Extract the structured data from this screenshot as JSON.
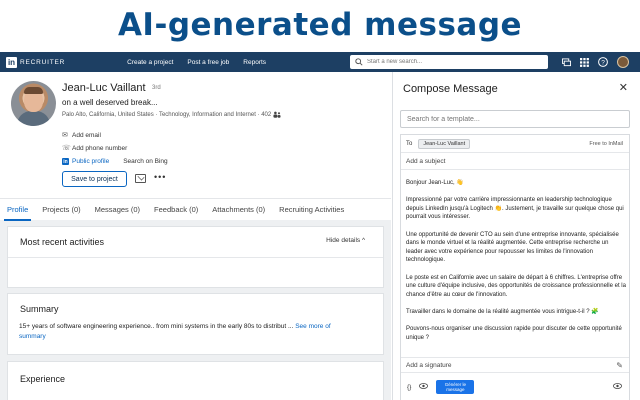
{
  "banner": {
    "title": "AI-generated message"
  },
  "topnav": {
    "brand": "RECRUITER",
    "links": [
      "Create a project",
      "Post a free job",
      "Reports"
    ],
    "search_placeholder": "Start a new search..."
  },
  "profile": {
    "name": "Jean-Luc Vaillant",
    "degree": "3rd",
    "headline": "on a well deserved break...",
    "meta": "Palo Alto, California, United States · Technology, Information and Internet · 402",
    "add_email": "Add email",
    "add_phone": "Add phone number",
    "public_profile": "Public profile",
    "search_bing": "Search on Bing",
    "save_button": "Save to project",
    "more": "•••"
  },
  "tabs": [
    {
      "label": "Profile",
      "active": true
    },
    {
      "label": "Projects (0)"
    },
    {
      "label": "Messages (0)"
    },
    {
      "label": "Feedback (0)"
    },
    {
      "label": "Attachments (0)"
    },
    {
      "label": "Recruiting Activities"
    }
  ],
  "activities": {
    "title": "Most recent activities",
    "hide_details": "Hide details ^"
  },
  "summary": {
    "title": "Summary",
    "text": "15+ years of software engineering experience.. from mini systems in the early 80s to distribut ...",
    "see_more": "See more of summary"
  },
  "experience": {
    "title": "Experience"
  },
  "compose": {
    "title": "Compose Message",
    "template_placeholder": "Search for a template...",
    "to_label": "To",
    "recipient": "Jean-Luc Vaillant",
    "inmail": "Free to InMail",
    "subject_placeholder": "Add a subject",
    "body": [
      "Bonjour Jean-Luc, 👋",
      "Impressionné par votre carrière impressionnante en leadership technologique depuis LinkedIn jusqu'à Logitech 👏. Justement, je travaille sur quelque chose qui pourrait vous intéresser.",
      "Une opportunité de devenir CTO au sein d'une entreprise innovante, spécialisée dans le monde virtuel et la réalité augmentée. Cette entreprise recherche un leader avec votre expérience pour repousser les limites de l'innovation technologique.",
      "Le poste est en Californie avec un salaire de départ à 6 chiffres. L'entreprise offre une culture d'équipe inclusive, des opportunités de croissance professionnelle et la chance d'être au cœur de l'innovation.",
      "Travailler dans le domaine de la réalité augmentée vous intrigue-t-il ? 🧩",
      "Pouvons-nous organiser une discussion rapide pour discuter de cette opportunité unique ?"
    ],
    "signature_placeholder": "Add a signature",
    "generate_button": "Générer le message"
  },
  "colors": {
    "nav": "#1d3f63",
    "accent": "#0a66c2",
    "banner_text": "#0b4f8a"
  }
}
